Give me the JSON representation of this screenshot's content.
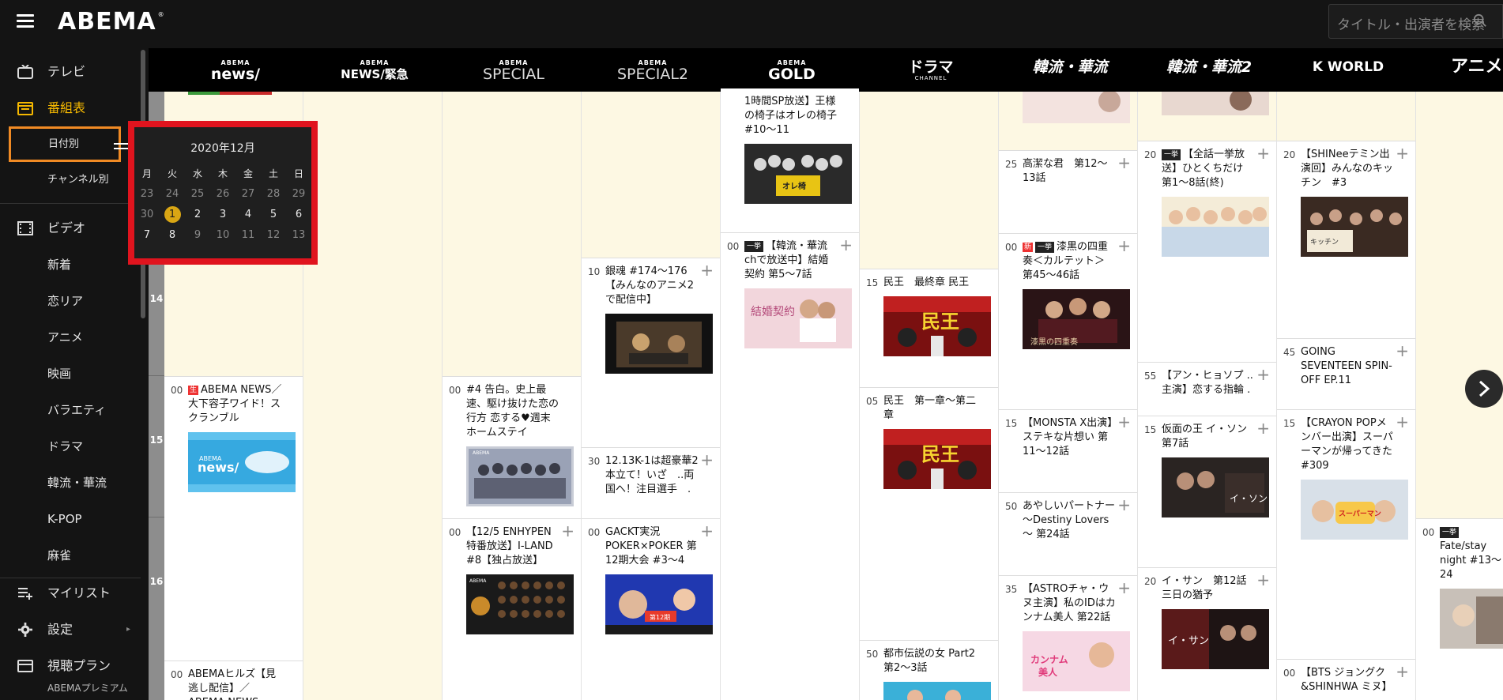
{
  "header": {
    "logo": "ABEMA",
    "search_placeholder": "タイトル・出演者を検索"
  },
  "sidebar": {
    "items": [
      {
        "name": "tv",
        "label": "テレビ",
        "icon": "tv-icon",
        "active": false
      },
      {
        "name": "schedule",
        "label": "番組表",
        "icon": "calendar-icon",
        "active": true
      },
      {
        "name": "video",
        "label": "ビデオ",
        "icon": "film-icon",
        "active": false
      },
      {
        "name": "mylist",
        "label": "マイリスト",
        "icon": "list-icon",
        "active": false
      },
      {
        "name": "settings",
        "label": "設定",
        "icon": "gear-icon",
        "active": false
      },
      {
        "name": "plan",
        "label": "視聴プラン",
        "icon": "card-icon",
        "active": false
      }
    ],
    "schedule_sub": [
      "日付別",
      "チャンネル別"
    ],
    "video_sub": [
      "新着",
      "恋リア",
      "アニメ",
      "映画",
      "バラエティ",
      "ドラマ",
      "韓流・華流",
      "K-POP",
      "麻雀"
    ],
    "plan_sub": "ABEMAプレミアム",
    "active_color": "#f5b800",
    "highlight_color": "#f08a24"
  },
  "channels": [
    {
      "top": "ABEMA",
      "main": "news/"
    },
    {
      "top": "ABEMA",
      "main": "NEWS/緊急"
    },
    {
      "top": "ABEMA",
      "main": "SPECIAL"
    },
    {
      "top": "ABEMA",
      "main": "SPECIAL2"
    },
    {
      "top": "ABEMA",
      "main": "GOLD"
    },
    {
      "top": "",
      "main": "ドラマ"
    },
    {
      "top": "",
      "main": "韓流・華流"
    },
    {
      "top": "",
      "main": "韓流・華流2"
    },
    {
      "top": "",
      "main": "K WORLD"
    },
    {
      "top": "",
      "main": "アニメ"
    }
  ],
  "hours": [
    "14",
    "15",
    "16"
  ],
  "programs": {
    "c0": [
      {
        "min": "00",
        "badge": "生",
        "title": "ABEMA NEWS／大下容子ワイド！スクランブル",
        "thumb": "news"
      },
      {
        "min": "00",
        "title": "ABEMAヒルズ【見逃し配信】／ABEMA NEWS"
      }
    ],
    "c2": [
      {
        "min": "00",
        "title": "#4 告白。史上最速、駆け抜けた恋の行方 恋する♥週末ホームステイ",
        "thumb": "group"
      },
      {
        "min": "00",
        "title": "【12/5 ENHYPEN特番放送】I-LAND #8【独占放送】",
        "thumb": "iland"
      }
    ],
    "c3": [
      {
        "min": "10",
        "title": "銀魂 #174～176【みんなのアニメ2で配信中】",
        "thumb": "anime"
      },
      {
        "min": "30",
        "title": "12.13K-1は超豪華2本立て！いざ　..両国へ！注目選手　."
      },
      {
        "min": "00",
        "title": "GACKT実況POKER×POKER 第12期大会 #3～4",
        "thumb": "poker"
      }
    ],
    "c4": [
      {
        "min": "",
        "title": "1時間SP放送】王様の椅子はオレの椅子 #10～11",
        "thumb": "chair"
      },
      {
        "min": "00",
        "badge": "一挙",
        "title": "【韓流・華流chで放送中】結婚契約 第5～7話",
        "thumb": "wedding"
      }
    ],
    "c5": [
      {
        "min": "15",
        "title": "民王　最終章 民王",
        "thumb": "tamiou"
      },
      {
        "min": "05",
        "title": "民王　第一章～第二章",
        "thumb": "tamiou"
      },
      {
        "min": "50",
        "title": "都市伝説の女 Part2 第2～3話",
        "thumb": "toshi"
      }
    ],
    "c6": [
      {
        "min": "25",
        "title": "高潔な君　第12～13話"
      },
      {
        "min": "00",
        "badge": "新",
        "badge2": "一挙",
        "title": "漆黒の四重奏＜カルテット＞ 第45～46話",
        "thumb": "quartet"
      },
      {
        "min": "15",
        "title": "【MONSTA X出演】ステキな片想い 第11～12話"
      },
      {
        "min": "50",
        "title": "あやしいパートナー ～Destiny Lovers～ 第24話"
      },
      {
        "min": "35",
        "title": "【ASTROチャ・ウヌ主演】私のIDはカンナム美人 第22話",
        "thumb": "gangnam"
      }
    ],
    "c7": [
      {
        "min": "20",
        "badge": "一挙",
        "title": "【全話一挙放送】ひとくちだけ 第1～8話(終)",
        "thumb": "hitokuchi"
      },
      {
        "min": "55",
        "title": "【アン・ヒョソプ ..主演】恋する指輪 ."
      },
      {
        "min": "15",
        "title": "仮面の王 イ・ソン 第7話",
        "thumb": "ison"
      },
      {
        "min": "20",
        "title": "イ・サン　第12話 三日の猶予",
        "thumb": "isan"
      }
    ],
    "c8": [
      {
        "min": "20",
        "title": "【SHINeeテミン出演回】みんなのキッチン　#3",
        "thumb": "kitchen"
      },
      {
        "min": "45",
        "title": "GOING SEVENTEEN SPIN-OFF EP.11"
      },
      {
        "min": "15",
        "title": "【CRAYON POPメンバー出演】スーパーマンが帰ってきた　#309",
        "thumb": "superman"
      },
      {
        "min": "00",
        "title": "【BTS ジョングク&SHINHWA ミヌ】"
      }
    ],
    "c9": [
      {
        "min": "00",
        "badge": "一挙",
        "title": "Fate/stay night #13～24",
        "thumb": "fate"
      }
    ]
  },
  "calendar": {
    "title": "2020年12月",
    "weekdays": [
      "月",
      "火",
      "水",
      "木",
      "金",
      "土",
      "日"
    ],
    "weeks": [
      [
        "23",
        "24",
        "25",
        "26",
        "27",
        "28",
        "29"
      ],
      [
        "30",
        "1",
        "2",
        "3",
        "4",
        "5",
        "6"
      ],
      [
        "7",
        "8",
        "9",
        "10",
        "11",
        "12",
        "13"
      ]
    ],
    "selected": "1",
    "selected_color": "#d9a614",
    "border_color": "#e0141e"
  }
}
